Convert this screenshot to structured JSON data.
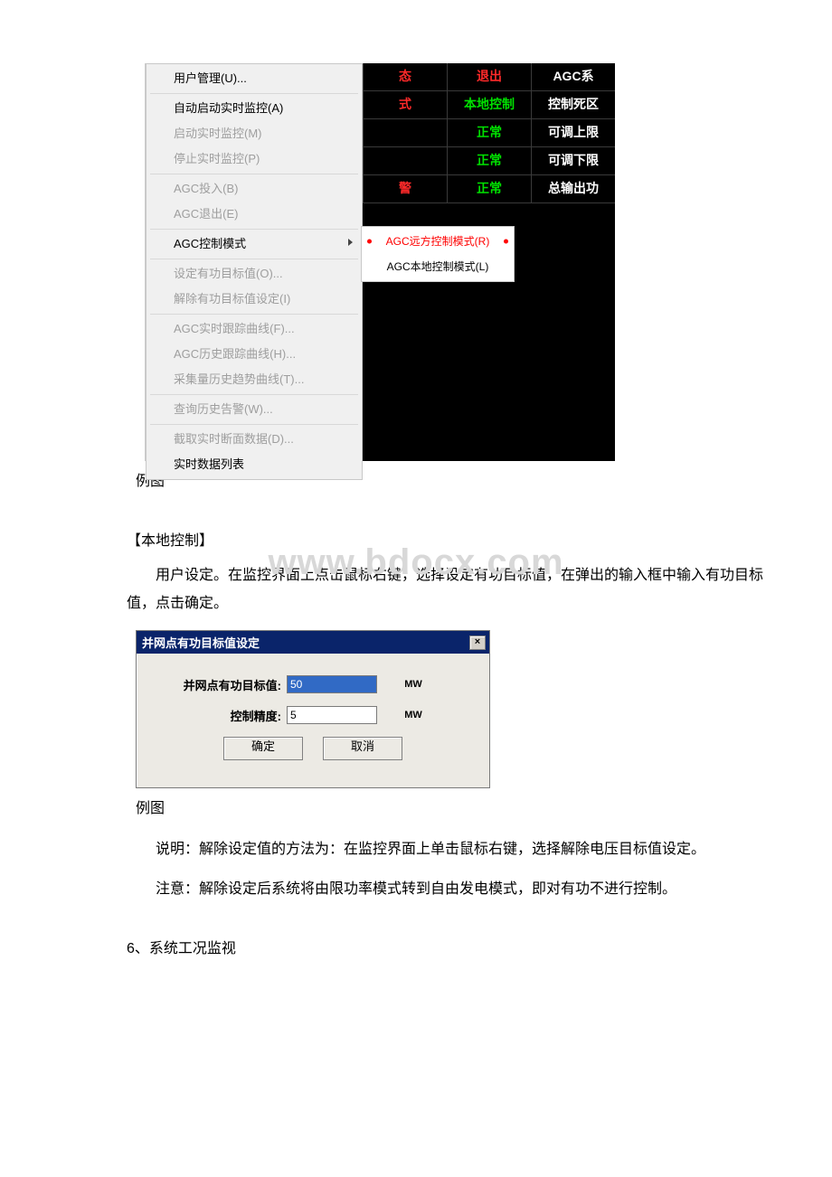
{
  "menu": {
    "items": [
      {
        "label": "用户管理(U)...",
        "enabled": true
      },
      {
        "sep": true
      },
      {
        "label": "自动启动实时监控(A)",
        "enabled": true
      },
      {
        "label": "启动实时监控(M)",
        "enabled": false
      },
      {
        "label": "停止实时监控(P)",
        "enabled": false
      },
      {
        "sep": true
      },
      {
        "label": "AGC投入(B)",
        "enabled": false
      },
      {
        "label": "AGC退出(E)",
        "enabled": false
      },
      {
        "sep": true
      },
      {
        "label": "AGC控制模式",
        "enabled": true,
        "submenu": true
      },
      {
        "sep": true
      },
      {
        "label": "设定有功目标值(O)...",
        "enabled": false
      },
      {
        "label": "解除有功目标值设定(I)",
        "enabled": false
      },
      {
        "sep": true
      },
      {
        "label": "AGC实时跟踪曲线(F)...",
        "enabled": false
      },
      {
        "label": "AGC历史跟踪曲线(H)...",
        "enabled": false
      },
      {
        "label": "采集量历史趋势曲线(T)...",
        "enabled": false
      },
      {
        "sep": true
      },
      {
        "label": "查询历史告警(W)...",
        "enabled": false
      },
      {
        "sep": true
      },
      {
        "label": "截取实时断面数据(D)...",
        "enabled": false
      },
      {
        "label": "实时数据列表",
        "enabled": true
      }
    ],
    "submenu": {
      "selected": "AGC远方控制模式(R)",
      "other": "AGC本地控制模式(L)"
    }
  },
  "panel": {
    "rows": [
      {
        "c1": {
          "text": "态",
          "color": "red"
        },
        "c2": {
          "text": "退出",
          "color": "red"
        },
        "c3": {
          "text": "AGC系",
          "color": "white"
        }
      },
      {
        "c1": {
          "text": "式",
          "color": "red"
        },
        "c2": {
          "text": "本地控制",
          "color": "green"
        },
        "c3": {
          "text": "控制死区",
          "color": "white"
        }
      },
      {
        "c1": {
          "text": "",
          "color": "white"
        },
        "c2": {
          "text": "正常",
          "color": "green"
        },
        "c3": {
          "text": "可调上限",
          "color": "white"
        }
      },
      {
        "c1": {
          "text": "",
          "color": "white"
        },
        "c2": {
          "text": "正常",
          "color": "green"
        },
        "c3": {
          "text": "可调下限",
          "color": "white"
        }
      },
      {
        "c1": {
          "text": "警",
          "color": "red"
        },
        "c2": {
          "text": "正常",
          "color": "green"
        },
        "c3": {
          "text": "总输出功",
          "color": "white"
        }
      }
    ]
  },
  "text": {
    "caption1": "例图",
    "section1_title": "【本地控制】",
    "para1": "用户设定。在监控界面上点击鼠标右键，选择设定有功目标值，在弹出的输入框中输入有功目标值，点击确定。",
    "caption2": "例图",
    "para2": "说明：解除设定值的方法为：在监控界面上单击鼠标右键，选择解除电压目标值设定。",
    "para3": "注意：解除设定后系统将由限功率模式转到自由发电模式，即对有功不进行控制。",
    "section2_title": "6、系统工况监视",
    "watermark": "www.bdocx.com"
  },
  "dialog": {
    "title": "并网点有功目标值设定",
    "field1_label": "并网点有功目标值:",
    "field1_value": "50",
    "field1_unit": "MW",
    "field2_label": "控制精度:",
    "field2_value": "5",
    "field2_unit": "MW",
    "ok": "确定",
    "cancel": "取消"
  }
}
